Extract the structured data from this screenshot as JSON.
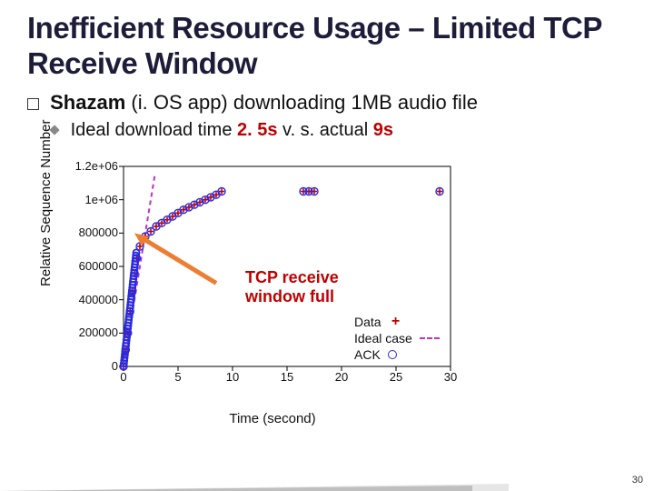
{
  "title": "Inefficient Resource Usage – Limited TCP Receive Window",
  "bullet1": {
    "lead": "Shazam",
    "rest": " (i. OS app) downloading 1MB audio file"
  },
  "bullet2": {
    "a": "Ideal download time ",
    "t1": "2. 5s",
    "b": " v. s. actual ",
    "t2": "9s"
  },
  "callout": {
    "l1": "TCP receive",
    "l2": "window full"
  },
  "legend": {
    "data": "Data",
    "ideal": "Ideal case",
    "ack": "ACK"
  },
  "xlabel": "Time (second)",
  "ylabel": "Relative Sequence Number",
  "page": "30",
  "chart_data": {
    "type": "scatter",
    "title": "",
    "xlabel": "Time (second)",
    "ylabel": "Relative Sequence Number",
    "xlim": [
      0,
      30
    ],
    "ylim": [
      0,
      1200000
    ],
    "xticks": [
      0,
      5,
      10,
      15,
      20,
      25,
      30
    ],
    "yticks": [
      0,
      200000,
      400000,
      600000,
      800000,
      1000000,
      1200000
    ],
    "ytick_labels": [
      "0",
      "200000",
      "400000",
      "600000",
      "800000",
      "1e+06",
      "1.2e+06"
    ],
    "series": [
      {
        "name": "Ideal case",
        "style": "dashed",
        "color": "#c330c3",
        "x": [
          0,
          2.5
        ],
        "y": [
          0,
          1000000
        ]
      },
      {
        "name": "Data",
        "style": "point-plus",
        "color": "#c00000",
        "x": [
          0.0,
          0.2,
          0.4,
          0.6,
          0.8,
          1.0,
          1.2,
          1.5,
          2.0,
          2.5,
          3.0,
          3.5,
          4.0,
          4.5,
          5.0,
          5.5,
          6.0,
          6.5,
          7.0,
          7.5,
          8.0,
          8.5,
          9.0,
          16.5,
          17.0,
          17.5,
          29.0
        ],
        "y": [
          0,
          100000,
          200000,
          330000,
          450000,
          560000,
          650000,
          720000,
          780000,
          810000,
          840000,
          860000,
          880000,
          900000,
          920000,
          940000,
          955000,
          970000,
          985000,
          1000000,
          1015000,
          1030000,
          1050000,
          1050000,
          1050000,
          1050000,
          1050000
        ]
      },
      {
        "name": "ACK",
        "style": "point-circle",
        "color": "#2a2adf",
        "x": [
          0.0,
          0.2,
          0.4,
          0.6,
          0.8,
          1.0,
          1.2,
          1.5,
          2.0,
          2.5,
          3.0,
          3.5,
          4.0,
          4.5,
          5.0,
          5.5,
          6.0,
          6.5,
          7.0,
          7.5,
          8.0,
          8.5,
          9.0,
          16.5,
          17.0,
          17.5,
          29.0
        ],
        "y": [
          0,
          100000,
          200000,
          330000,
          450000,
          560000,
          650000,
          720000,
          780000,
          810000,
          840000,
          860000,
          880000,
          900000,
          920000,
          940000,
          955000,
          970000,
          985000,
          1000000,
          1015000,
          1030000,
          1050000,
          1050000,
          1050000,
          1050000,
          1050000
        ]
      }
    ],
    "annotation": {
      "text": "TCP receive window full",
      "arrow_to_xy": [
        1.0,
        800000
      ]
    }
  }
}
